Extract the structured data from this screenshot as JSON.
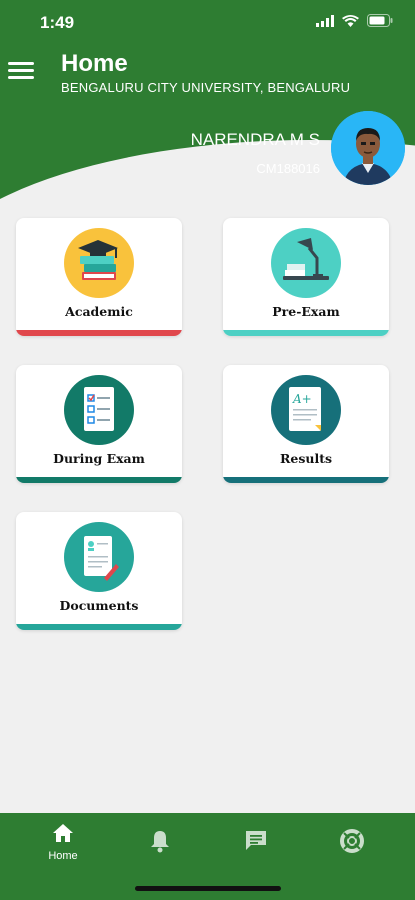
{
  "status": {
    "time": "1:49"
  },
  "header": {
    "title": "Home",
    "subtitle": "BENGALURU CITY UNIVERSITY, BENGALURU",
    "user_name": "NARENDRA M S",
    "user_id": "CM188016"
  },
  "cards": [
    {
      "label": "Academic",
      "icon": "graduation-books-icon",
      "circle_color": "#f9c23c",
      "bar_color": "#e0474c"
    },
    {
      "label": "Pre-Exam",
      "icon": "desk-lamp-icon",
      "circle_color": "#4dd0c4",
      "bar_color": "#4dd0c4"
    },
    {
      "label": "During Exam",
      "icon": "checklist-icon",
      "circle_color": "#127a68",
      "bar_color": "#127a68"
    },
    {
      "label": "Results",
      "icon": "grade-sheet-icon",
      "circle_color": "#16707a",
      "bar_color": "#16707a"
    },
    {
      "label": "Documents",
      "icon": "document-pen-icon",
      "circle_color": "#26a69a",
      "bar_color": "#26a69a"
    }
  ],
  "nav": [
    {
      "label": "Home",
      "icon": "home-icon"
    },
    {
      "label": "",
      "icon": "bell-icon"
    },
    {
      "label": "",
      "icon": "chat-icon"
    },
    {
      "label": "",
      "icon": "lifebuoy-icon"
    }
  ],
  "colors": {
    "primary": "#2e7d32",
    "background": "#f0f0f0"
  }
}
